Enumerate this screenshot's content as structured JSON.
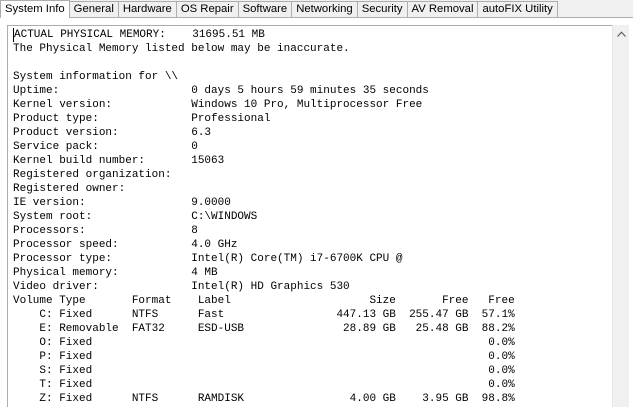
{
  "tabs": [
    {
      "label": "System Info",
      "active": true
    },
    {
      "label": "General"
    },
    {
      "label": "Hardware"
    },
    {
      "label": "OS Repair"
    },
    {
      "label": "Software"
    },
    {
      "label": "Networking"
    },
    {
      "label": "Security"
    },
    {
      "label": "AV Removal"
    },
    {
      "label": "autoFIX Utility"
    }
  ],
  "report": {
    "lines": [
      "ACTUAL PHYSICAL MEMORY:    31695.51 MB",
      "The Physical Memory listed below may be inaccurate.",
      "",
      "System information for \\\\",
      "Uptime:                    0 days 5 hours 59 minutes 35 seconds",
      "Kernel version:            Windows 10 Pro, Multiprocessor Free",
      "Product type:              Professional",
      "Product version:           6.3",
      "Service pack:              0",
      "Kernel build number:       15063",
      "Registered organization:",
      "Registered owner:",
      "IE version:                9.0000",
      "System root:               C:\\WINDOWS",
      "Processors:                8",
      "Processor speed:           4.0 GHz",
      "Processor type:            Intel(R) Core(TM) i7-6700K CPU @",
      "Physical memory:           4 MB",
      "Video driver:              Intel(R) HD Graphics 530",
      "Volume Type       Format    Label                     Size       Free   Free",
      "    C: Fixed      NTFS      Fast                 447.13 GB  255.47 GB  57.1%",
      "    E: Removable  FAT32     ESD-USB               28.89 GB   25.48 GB  88.2%",
      "    O: Fixed                                                            0.0%",
      "    P: Fixed                                                            0.0%",
      "    S: Fixed                                                            0.0%",
      "    T: Fixed                                                            0.0%",
      "    Z: Fixed      NTFS      RAMDISK                4.00 GB    3.95 GB  98.8%"
    ]
  }
}
